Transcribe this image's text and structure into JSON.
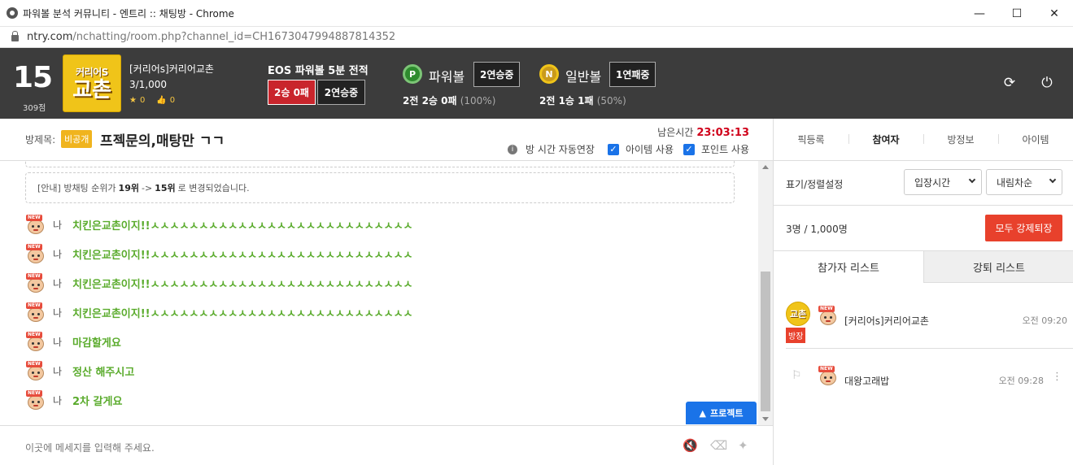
{
  "window": {
    "title": "파워볼 분석 커뮤니티 - 엔트리 :: 채팅방 - Chrome",
    "url_host": "ntry.com",
    "url_path": "/nchatting/room.php?channel_id=CH1673047994887814352"
  },
  "header": {
    "rank": "15",
    "rank_points": "309점",
    "logo_line1": "커리어S",
    "logo_line2": "교촌",
    "room_name": "[커리어s]커리어교촌",
    "room_count": "3/1,000",
    "stars": "0",
    "likes": "0",
    "eos_title": "EOS 파워볼 5분 전적",
    "eos_record": "2승 0패",
    "eos_streak": "2연승중",
    "powerball": {
      "icon_letter": "P",
      "label": "파워볼",
      "streak": "2연승중",
      "record": "2전 2승 0패",
      "pct": "(100%)"
    },
    "normalball": {
      "icon_letter": "N",
      "label": "일반볼",
      "streak": "1연패중",
      "record": "2전 1승 1패",
      "pct": "(50%)"
    }
  },
  "subheader": {
    "subject_label": "방제목:",
    "private_badge": "비공개",
    "subject_title": "프젝문의,매탕만 ㄱㄱ",
    "remain_label": "남은시간",
    "remain_time": "23:03:13",
    "auto_extend": "방 시간 자동연장",
    "use_item": "아이템 사용",
    "use_point": "포인트 사용"
  },
  "right_tabs": [
    "픽등록",
    "참여자",
    "방정보",
    "아이템"
  ],
  "chat": {
    "notice_prefix": "[안내] 방채팅 순위가",
    "notice_from": "19위",
    "notice_arrow": "->",
    "notice_to": "15위",
    "notice_suffix": "로 변경되었습니다.",
    "messages": [
      {
        "who": "나",
        "text": "치킨은교촌이지!!ㅅㅅㅅㅅㅅㅅㅅㅅㅅㅅㅅㅅㅅㅅㅅㅅㅅㅅㅅㅅㅅㅅㅅㅅㅅㅅㅅ"
      },
      {
        "who": "나",
        "text": "치킨은교촌이지!!ㅅㅅㅅㅅㅅㅅㅅㅅㅅㅅㅅㅅㅅㅅㅅㅅㅅㅅㅅㅅㅅㅅㅅㅅㅅㅅㅅ"
      },
      {
        "who": "나",
        "text": "치킨은교촌이지!!ㅅㅅㅅㅅㅅㅅㅅㅅㅅㅅㅅㅅㅅㅅㅅㅅㅅㅅㅅㅅㅅㅅㅅㅅㅅㅅㅅ"
      },
      {
        "who": "나",
        "text": "치킨은교촌이지!!ㅅㅅㅅㅅㅅㅅㅅㅅㅅㅅㅅㅅㅅㅅㅅㅅㅅㅅㅅㅅㅅㅅㅅㅅㅅㅅㅅ"
      },
      {
        "who": "나",
        "text": "마감할게요"
      },
      {
        "who": "나",
        "text": "정산 해주시고"
      },
      {
        "who": "나",
        "text": "2차 갈게요"
      }
    ],
    "project_button": "프로젝트",
    "input_placeholder": "이곳에 메세지를 입력해 주세요."
  },
  "panel": {
    "sort_label": "표기/정렬설정",
    "sort_select": "입장시간",
    "order_select": "내림차순",
    "count_text": "3명 / 1,000명",
    "kick_all": "모두 강제퇴장",
    "tab_participants": "참가자 리스트",
    "tab_kicked": "강퇴 리스트",
    "members": [
      {
        "name": "[커리어s]커리어교촌",
        "time": "오전 09:20",
        "badge": "방장",
        "logo": "교촌"
      },
      {
        "name": "대왕고래밥",
        "time": "오전 09:28"
      }
    ]
  },
  "colors": {
    "header_bg": "#3c3c3c",
    "chat_green": "#5aab2c",
    "accent_blue": "#1a73e8",
    "danger_red": "#e8412c",
    "timer_red": "#d0021b"
  }
}
